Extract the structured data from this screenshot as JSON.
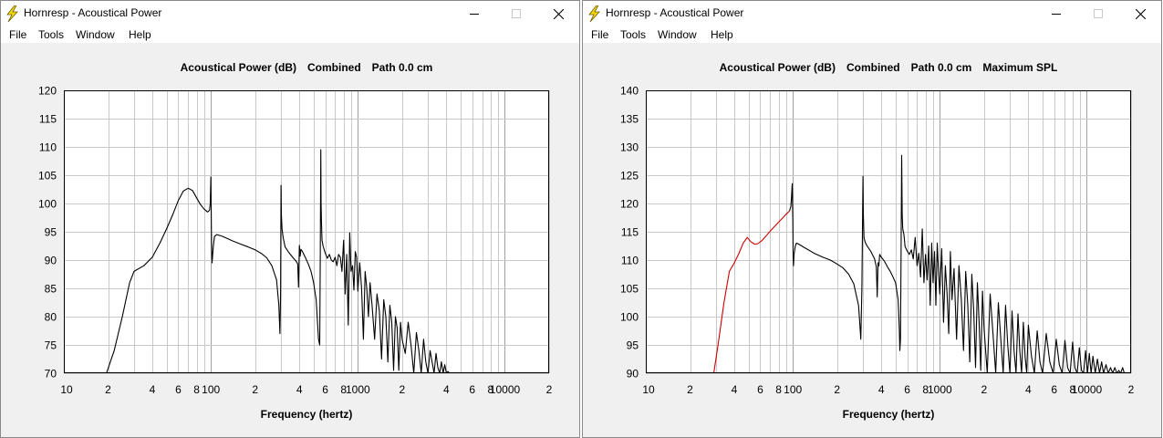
{
  "colors": {
    "curve": "#000000",
    "curve_highlight": "#d00000",
    "grid": "#c8c8c8",
    "plot_border": "#000000"
  },
  "windows": [
    {
      "title": "Hornresp - Acoustical Power",
      "app_icon": "lightning-bolt-icon",
      "menu": [
        "File",
        "Tools",
        "Window",
        "Help"
      ],
      "chart_title_parts": [
        "Acoustical Power (dB)",
        "Combined",
        "Path 0.0 cm"
      ],
      "chart_data": {
        "type": "line",
        "title": "Acoustical Power (dB)   Combined   Path 0.0 cm",
        "xlabel": "Frequency (hertz)",
        "ylabel": "",
        "xscale": "log",
        "xlim": [
          10,
          20000
        ],
        "ylim": [
          70,
          120
        ],
        "ytick_labels": [
          "120",
          "115",
          "110",
          "105",
          "100",
          "95",
          "90",
          "85",
          "80",
          "75",
          "70"
        ],
        "xtick_labels": [
          "10",
          "2",
          "4",
          "6",
          "8",
          "100",
          "2",
          "4",
          "6",
          "8",
          "1000",
          "2",
          "4",
          "6",
          "8",
          "10000",
          "2"
        ],
        "grid": true,
        "series": [
          {
            "color": "#000000",
            "x": [
              19.5,
              22,
              25,
              28,
              30,
              35,
              40,
              45,
              50,
              55,
              60,
              65,
              70,
              75,
              80,
              85,
              90,
              95,
              98,
              99,
              100,
              101,
              102,
              104,
              106,
              110,
              120,
              140,
              160,
              180,
              200,
              220,
              240,
              260,
              280,
              290,
              295,
              298,
              300,
              302,
              305,
              310,
              320,
              340,
              360,
              380,
              390,
              395,
              400,
              405,
              410,
              420,
              440,
              460,
              480,
              500,
              520,
              540,
              550,
              555,
              560,
              562,
              565,
              570,
              580,
              600,
              620,
              640,
              660,
              680,
              700,
              720,
              740,
              760,
              780,
              800,
              820,
              840,
              860,
              880,
              900,
              920,
              940,
              960,
              980,
              1000,
              1030,
              1060,
              1090,
              1120,
              1150,
              1180,
              1210,
              1250,
              1300,
              1350,
              1400,
              1450,
              1500,
              1550,
              1600,
              1650,
              1700,
              1750,
              1800,
              1850,
              1900,
              1950,
              2000,
              2100,
              2200,
              2300,
              2400,
              2500,
              2600,
              2700,
              2800,
              2900,
              3000,
              3100,
              3200,
              3300,
              3400,
              3500,
              3600,
              3700,
              3800,
              3900,
              4000,
              4100,
              4200
            ],
            "y": [
              70,
              74,
              80,
              86,
              88,
              89,
              90.5,
              93,
              95.5,
              98,
              100.5,
              102.2,
              102.7,
              102.3,
              101,
              99.8,
              99,
              98.5,
              98.8,
              100,
              104.7,
              93,
              89.5,
              92.5,
              94.2,
              94.5,
              94.2,
              93.4,
              92.8,
              92.3,
              91.8,
              91.2,
              90.4,
              89,
              86.5,
              82,
              77,
              84,
              103.2,
              98,
              95.5,
              94,
              92.3,
              91.3,
              90.5,
              89.8,
              89.3,
              85.2,
              92.6,
              90.7,
              91.9,
              91.5,
              90.4,
              89.3,
              88,
              86,
              83,
              76,
              75,
              90,
              109.5,
              100,
              97,
              93.5,
              92.5,
              91.2,
              90.3,
              91,
              90,
              89.7,
              90.5,
              89,
              91,
              90.5,
              88,
              93.5,
              84,
              91,
              78.5,
              94.8,
              88,
              89,
              84.7,
              91.5,
              90.5,
              84.5,
              89.5,
              85,
              76,
              88,
              85,
              80,
              86,
              82,
              76,
              84,
              81,
              72.5,
              83,
              80,
              72,
              82,
              79,
              70.5,
              80,
              78,
              70.5,
              79,
              76,
              73.5,
              79,
              75,
              70,
              77.2,
              74,
              70,
              76,
              72,
              70,
              74,
              72,
              70,
              73.5,
              71,
              70,
              72,
              70,
              71.5,
              70,
              70.3,
              70
            ]
          }
        ]
      }
    },
    {
      "title": "Hornresp - Acoustical Power",
      "app_icon": "lightning-bolt-icon",
      "menu": [
        "File",
        "Tools",
        "Window",
        "Help"
      ],
      "chart_title_parts": [
        "Acoustical Power (dB)",
        "Combined",
        "Path 0.0 cm",
        "Maximum SPL"
      ],
      "chart_data": {
        "type": "line",
        "title": "Acoustical Power (dB)   Combined   Path 0.0 cm   Maximum SPL",
        "xlabel": "Frequency (hertz)",
        "ylabel": "",
        "xscale": "log",
        "xlim": [
          10,
          20000
        ],
        "ylim": [
          90,
          140
        ],
        "ytick_labels": [
          "140",
          "135",
          "130",
          "125",
          "120",
          "115",
          "110",
          "105",
          "100",
          "95",
          "90"
        ],
        "xtick_labels": [
          "10",
          "2",
          "4",
          "6",
          "8",
          "100",
          "2",
          "4",
          "6",
          "8",
          "1000",
          "2",
          "4",
          "6",
          "8",
          "10000",
          "2"
        ],
        "grid": true,
        "series": [
          {
            "color": "#d00000",
            "x": [
              29,
              31,
              34,
              37,
              40,
              43,
              46,
              49,
              52,
              55,
              58,
              62,
              66,
              70,
              75,
              80,
              85,
              90,
              95
            ],
            "y": [
              90,
              95,
              102.5,
              108,
              109.5,
              111.2,
              113,
              114,
              113.2,
              112.8,
              112.9,
              113.5,
              114.3,
              115.1,
              115.9,
              116.7,
              117.4,
              118.1,
              118.7
            ]
          },
          {
            "color": "#000000",
            "x": [
              95,
              97,
              98,
              99,
              100,
              100.5,
              101,
              102,
              104,
              106,
              110,
              120,
              140,
              160,
              180,
              200,
              220,
              240,
              260,
              280,
              285,
              290,
              295,
              300,
              302,
              305,
              310,
              320,
              340,
              360,
              370,
              375,
              380,
              385,
              390,
              400,
              420,
              440,
              460,
              480,
              500,
              520,
              530,
              535,
              540,
              545,
              550,
              555,
              560,
              570,
              580,
              600,
              620,
              640,
              660,
              680,
              700,
              720,
              740,
              760,
              780,
              800,
              820,
              840,
              860,
              880,
              900,
              920,
              940,
              960,
              980,
              1000,
              1030,
              1060,
              1090,
              1120,
              1150,
              1180,
              1210,
              1250,
              1300,
              1350,
              1400,
              1450,
              1500,
              1550,
              1600,
              1650,
              1700,
              1750,
              1800,
              1850,
              1900,
              1950,
              2000,
              2100,
              2200,
              2300,
              2400,
              2500,
              2600,
              2700,
              2800,
              2900,
              3000,
              3100,
              3200,
              3300,
              3400,
              3500,
              3600,
              3700,
              3800,
              3900,
              4000,
              4200,
              4400,
              4600,
              4800,
              5000,
              5300,
              5600,
              5900,
              6200,
              6500,
              6800,
              7100,
              7400,
              7700,
              8000,
              8300,
              8600,
              8900,
              9200,
              9500,
              9800,
              10100,
              10400,
              10700,
              11000,
              11400,
              11800,
              12200,
              12600,
              13000,
              13500,
              14000,
              14500,
              15000,
              15500,
              16000,
              16500,
              17000,
              17500,
              18000,
              18500,
              19000,
              19500,
              20000
            ],
            "y": [
              118.7,
              119.5,
              121,
              123.5,
              117,
              110.5,
              109,
              111,
              112.5,
              113,
              112.8,
              112.2,
              111.2,
              110.5,
              110,
              109.3,
              108.6,
              107.5,
              105.8,
              102,
              99,
              96,
              105,
              124.8,
              118,
              114,
              113.2,
              112.5,
              111.5,
              110.2,
              108.8,
              103.5,
              109.5,
              109,
              111,
              110.5,
              109.8,
              108.8,
              108,
              107,
              106,
              103,
              98,
              94,
              96,
              110,
              128.5,
              118,
              115.5,
              114.5,
              112.4,
              111.6,
              111,
              111.8,
              110.2,
              114,
              109,
              111.2,
              107,
              115.5,
              106,
              111,
              106.5,
              112.5,
              102,
              113,
              106,
              111.5,
              102,
              113,
              108,
              104,
              112,
              99,
              109,
              104,
              97,
              111.5,
              103,
              108.5,
              96,
              109,
              103,
              94,
              108,
              102,
              92,
              107.5,
              101,
              91,
              106,
              99,
              90.5,
              104.5,
              98,
              90,
              104,
              97,
              90,
              102.5,
              96,
              90,
              102,
              95,
              90,
              101,
              94,
              90,
              100.5,
              94,
              90,
              99,
              93,
              90,
              98.5,
              93,
              90,
              97.5,
              92,
              90,
              97,
              92,
              90,
              96,
              91.5,
              90,
              95.8,
              91,
              90,
              95.5,
              91,
              90,
              94.5,
              90.5,
              90,
              94,
              90,
              93.5,
              90,
              93,
              90,
              92.5,
              90,
              92,
              90,
              91.5,
              90,
              91,
              90,
              91,
              90,
              90.5,
              90,
              91,
              90
            ]
          }
        ]
      }
    }
  ]
}
